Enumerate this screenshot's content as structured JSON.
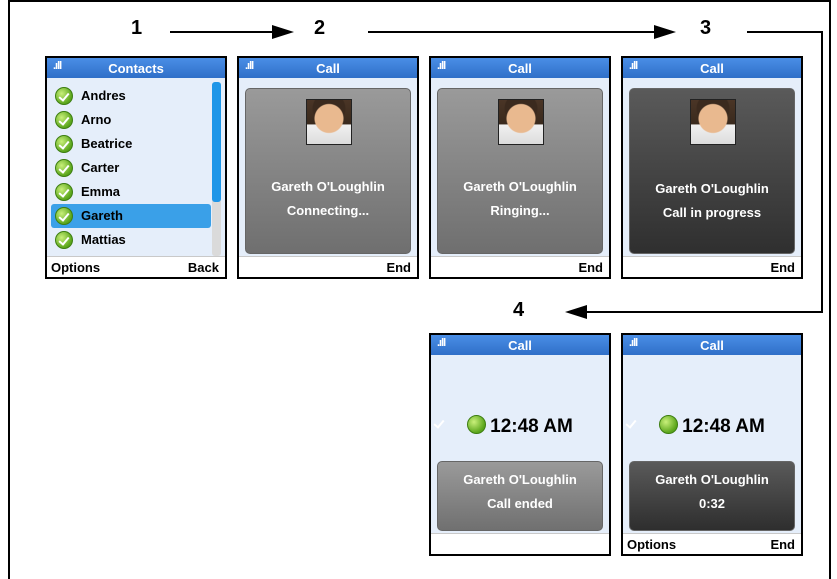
{
  "steps": [
    "1",
    "2",
    "3",
    "4"
  ],
  "signal_glyph": ".ıll",
  "phones": {
    "contacts": {
      "title": "Contacts",
      "items": [
        {
          "label": "Andres",
          "selected": false
        },
        {
          "label": "Arno",
          "selected": false
        },
        {
          "label": "Beatrice",
          "selected": false
        },
        {
          "label": "Carter",
          "selected": false
        },
        {
          "label": "Emma",
          "selected": false
        },
        {
          "label": "Gareth",
          "selected": true
        },
        {
          "label": "Mattias",
          "selected": false
        }
      ],
      "left_softkey": "Options",
      "right_softkey": "Back"
    },
    "connecting": {
      "title": "Call",
      "name": "Gareth O'Loughlin",
      "status": "Connecting...",
      "right_softkey": "End"
    },
    "ringing": {
      "title": "Call",
      "name": "Gareth O'Loughlin",
      "status": "Ringing...",
      "right_softkey": "End"
    },
    "in_progress": {
      "title": "Call",
      "name": "Gareth O'Loughlin",
      "status": "Call in progress",
      "right_softkey": "End"
    },
    "ended": {
      "title": "Call",
      "time": "12:48 AM",
      "name": "Gareth O'Loughlin",
      "status": "Call ended"
    },
    "summary": {
      "title": "Call",
      "time": "12:48 AM",
      "name": "Gareth O'Loughlin",
      "duration": "0:32",
      "left_softkey": "Options",
      "right_softkey": "End"
    }
  },
  "colors": {
    "titlebar": "#3a7fd9",
    "selection": "#3aa0e8",
    "screen": "#e5eefa",
    "presence": "#5aa51b"
  }
}
